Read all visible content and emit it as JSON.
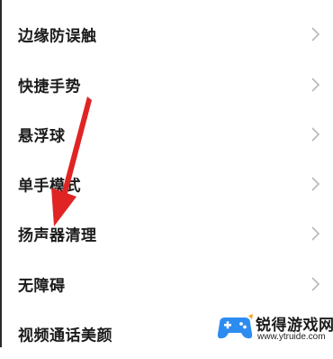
{
  "settings": {
    "items": [
      {
        "label": "边缘防误触"
      },
      {
        "label": "快捷手势"
      },
      {
        "label": "悬浮球"
      },
      {
        "label": "单手模式"
      },
      {
        "label": "扬声器清理"
      },
      {
        "label": "无障碍"
      },
      {
        "label": "视频通话美颜"
      }
    ],
    "chevron_icon": "chevron-right-icon"
  },
  "annotation": {
    "arrow_color": "#e02424",
    "points_to": "扬声器清理"
  },
  "watermark": {
    "title": "锐得游戏网",
    "url": "www.ytruide.com",
    "logo_icon": "gamepad-icon",
    "logo_color": "#2d8cf0"
  },
  "colors": {
    "text": "#1b1b1b",
    "chevron": "#b8b8b8",
    "background": "#ffffff"
  }
}
